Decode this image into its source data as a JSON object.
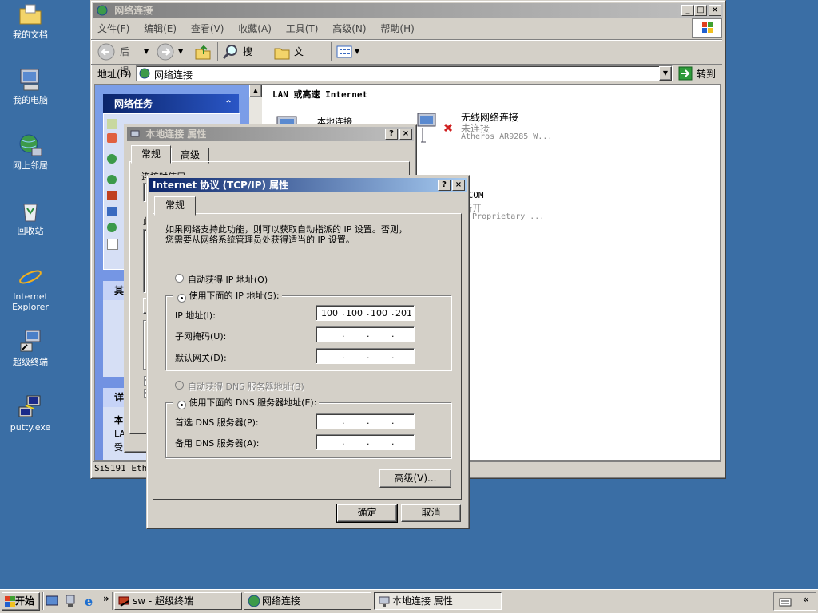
{
  "desktop": {
    "icons": [
      {
        "label": "我的文档"
      },
      {
        "label": "我的电脑"
      },
      {
        "label": "网上邻居"
      },
      {
        "label": "回收站"
      },
      {
        "label": "Internet Explorer"
      },
      {
        "label": "超级终端"
      },
      {
        "label": "putty.exe"
      }
    ]
  },
  "explorer": {
    "title": "网络连接",
    "menu": [
      "文件(F)",
      "编辑(E)",
      "查看(V)",
      "收藏(A)",
      "工具(T)",
      "高级(N)",
      "帮助(H)"
    ],
    "toolbar": {
      "back": "后退",
      "search": "搜索",
      "folders": "文件夹"
    },
    "address_label": "地址(D)",
    "address_value": "网络连接",
    "go_label": "转到",
    "tasks_header": "网络任务",
    "other_header": "其",
    "details_header": "详",
    "details_text": [
      "本",
      "LA",
      "受"
    ],
    "section_header": "LAN 或高速 Internet",
    "connections": [
      {
        "name": "本地连接",
        "status": "",
        "device": ""
      },
      {
        "name": "无线网络连接",
        "status": "未连接",
        "device": "Atheros AR9285 W..."
      },
      {
        "name": "ICOM",
        "status": "断开",
        "device": "2 Proprietary ..."
      }
    ],
    "statusbar": "SiS191 Ethe"
  },
  "local_props": {
    "title": "本地连接 属性",
    "tabs": [
      "常规",
      "高级"
    ],
    "connect_using": "连接时使用:",
    "this_label": "此"
  },
  "tcpip": {
    "title": "Internet 协议 (TCP/IP) 属性",
    "tab": "常规",
    "desc_line1": "如果网络支持此功能，则可以获取自动指派的 IP 设置。否则，",
    "desc_line2": "您需要从网络系统管理员处获得适当的 IP 设置。",
    "auto_ip": "自动获得 IP 地址(O)",
    "manual_ip": "使用下面的 IP 地址(S):",
    "ip_label": "IP 地址(I):",
    "ip_value": [
      "100",
      "100",
      "100",
      "201"
    ],
    "mask_label": "子网掩码(U):",
    "gateway_label": "默认网关(D):",
    "auto_dns": "自动获得 DNS 服务器地址(B)",
    "manual_dns": "使用下面的 DNS 服务器地址(E):",
    "dns1_label": "首选 DNS 服务器(P):",
    "dns2_label": "备用 DNS 服务器(A):",
    "advanced": "高级(V)...",
    "ok": "确定",
    "cancel": "取消"
  },
  "taskbar": {
    "start": "开始",
    "tasks": [
      {
        "label": "sw - 超级终端"
      },
      {
        "label": "网络连接"
      },
      {
        "label": "本地连接 属性"
      }
    ],
    "chevron": "»",
    "tray_chevron": "«"
  },
  "colors": {
    "desktop": "#3a6ea5",
    "title_active": "#0a246a",
    "face": "#d4d0c8"
  }
}
